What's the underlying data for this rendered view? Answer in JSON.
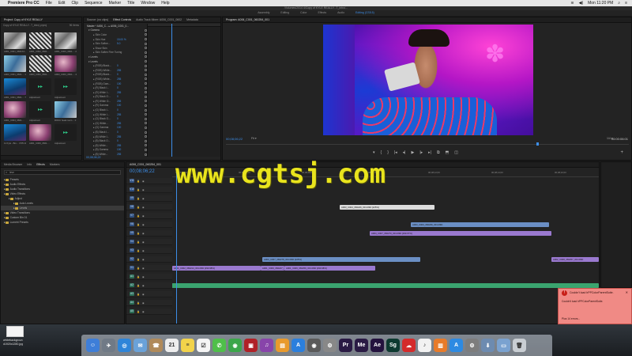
{
  "menubar": {
    "apple": "",
    "app_name": "Premiere Pro CC",
    "items": [
      "File",
      "Edit",
      "Clip",
      "Sequence",
      "Marker",
      "Title",
      "Window",
      "Help"
    ],
    "clock": "Mon 11:20 PM"
  },
  "titlebar": {
    "path": "/Volumes/2014 4/Copy of KYLE REALLY...T_intro/..."
  },
  "workspaces": {
    "tabs": [
      "Assembly",
      "Editing",
      "Color",
      "Effects",
      "Audio",
      "Editing (CS5.5)"
    ],
    "active": "Editing (CS5.5)"
  },
  "project": {
    "tab": "Project: Copy of KYLE REALLY",
    "file": "Copy of KYLE REALLY...T_intro).prproj",
    "items_count": "96 Items",
    "thumbs": [
      {
        "name": "A001_C001_0601X4....",
        "dur": "1:07:04"
      },
      {
        "name": "A001_C002_0601....",
        "dur": ""
      },
      {
        "name": "A001_C003_0601....",
        "dur": "25:00:03"
      },
      {
        "name": "A003_C001_0601....",
        "dur": "1:16:03"
      },
      {
        "name": "A003_C002_0601....",
        "dur": ""
      },
      {
        "name": "A003_C003_0601....",
        "dur": "4:05"
      },
      {
        "name": "A001_C001_0601....",
        "dur": "7:04"
      },
      {
        "name": "Adjustment",
        "dur": ""
      },
      {
        "name": "Adjustment",
        "dur": ""
      },
      {
        "name": "A001_C004_0601....",
        "dur": ""
      },
      {
        "name": "Adjustment",
        "dur": ""
      },
      {
        "name": "ROKU head-room...",
        "dur": "1:16:09"
      },
      {
        "name": "11 Kyle - Bro...",
        "dur": "3:55:14"
      },
      {
        "name": "A001_C006_0601....",
        "dur": ""
      },
      {
        "name": "Adjustment",
        "dur": ""
      }
    ]
  },
  "effect_controls": {
    "tabs": [
      "Source: (no clips)",
      "Effect Controls",
      "Audio Track Mixer: A006_C001_0602",
      "Metadata"
    ],
    "active_tab": "Effect Controls",
    "clip_path": "Master * A006_C... ▸ A006_C001_0...",
    "rows": [
      {
        "label": "Gamma",
        "value": "",
        "section": true
      },
      {
        "label": "Skin Color",
        "value": ""
      },
      {
        "label": "Skin Hue",
        "value": "15.00 %"
      },
      {
        "label": "Skin Softne...",
        "value": "5.0"
      },
      {
        "label": "Show Skin",
        "value": ""
      },
      {
        "label": "Skin Soften Fine Tuning",
        "value": ""
      },
      {
        "label": "Levels",
        "value": "",
        "section": true
      },
      {
        "label": "Levels",
        "value": "",
        "section": true
      },
      {
        "label": "(RGB) Black...",
        "value": "0"
      },
      {
        "label": "(RGB) White...",
        "value": "255"
      },
      {
        "label": "(RGB) Black...",
        "value": "0"
      },
      {
        "label": "(RGB) White...",
        "value": "255"
      },
      {
        "label": "(RGB) Gam...",
        "value": "100"
      },
      {
        "label": "(R) Black I...",
        "value": "0"
      },
      {
        "label": "(R) White I...",
        "value": "255"
      },
      {
        "label": "(R) Black O...",
        "value": "0"
      },
      {
        "label": "(R) White O...",
        "value": "255"
      },
      {
        "label": "(R) Gamma",
        "value": "100"
      },
      {
        "label": "(G) Black I...",
        "value": "0"
      },
      {
        "label": "(G) White I...",
        "value": "255"
      },
      {
        "label": "(G) Black O...",
        "value": "0"
      },
      {
        "label": "(G) White...",
        "value": "255"
      },
      {
        "label": "(G) Gamma",
        "value": "100"
      },
      {
        "label": "(B) Black I...",
        "value": "0"
      },
      {
        "label": "(B) White I...",
        "value": "255"
      },
      {
        "label": "(B) Black O...",
        "value": "0"
      },
      {
        "label": "(B) White...",
        "value": "255"
      },
      {
        "label": "(B) Gamma",
        "value": "100"
      },
      {
        "label": "(B) White...",
        "value": "255"
      }
    ],
    "timecode": "00;08;06;22"
  },
  "program": {
    "tab": "Program: A006_C001_060254_001",
    "timecode": "00;08;06;22",
    "fit": "Fit",
    "scale": "1/4",
    "duration": "00:00:06:01",
    "controls": [
      "▾",
      "{",
      "}",
      "|◂",
      "◂|",
      "▶",
      "|▸",
      "▸|",
      "⧉",
      "⬒",
      "◫"
    ],
    "playhead_fraction": 0.77
  },
  "effects_panel": {
    "tabs": [
      "Media Browser",
      "Info",
      "Effects",
      "Markers"
    ],
    "active_tab": "Effects",
    "search_value": "leve",
    "tree": [
      {
        "label": "Presets",
        "indent": 0
      },
      {
        "label": "Audio Effects",
        "indent": 0
      },
      {
        "label": "Audio Transitions",
        "indent": 0
      },
      {
        "label": "Video Effects",
        "indent": 0
      },
      {
        "label": "Adjust",
        "indent": 1
      },
      {
        "label": "Auto Levels",
        "indent": 2
      },
      {
        "label": "Levels",
        "indent": 2,
        "selected": true
      },
      {
        "label": "Video Transitions",
        "indent": 0
      },
      {
        "label": "Custom Bin 01",
        "indent": 0
      },
      {
        "label": "Lumetri Presets",
        "indent": 0
      }
    ]
  },
  "timeline": {
    "tab": "A006_C001_060254_001",
    "timecode": "00;08;06;22",
    "ticks": [
      "00;08;04;00",
      "00;08;06;00",
      "00;08;08;00",
      "00;08;10;00",
      "00;08;12;00",
      "00;08;14;00",
      "00;08;16;00"
    ],
    "tracks": [
      {
        "name": "V11",
        "kind": "v"
      },
      {
        "name": "V10",
        "kind": "v"
      },
      {
        "name": "V9",
        "kind": "v"
      },
      {
        "name": "V8",
        "kind": "v"
      },
      {
        "name": "V7",
        "kind": "v"
      },
      {
        "name": "V6",
        "kind": "v"
      },
      {
        "name": "V5",
        "kind": "v"
      },
      {
        "name": "V4",
        "kind": "v"
      },
      {
        "name": "V3",
        "kind": "v"
      },
      {
        "name": "V2",
        "kind": "v"
      },
      {
        "name": "V1",
        "kind": "v"
      },
      {
        "name": "A1",
        "kind": "a"
      },
      {
        "name": "A2",
        "kind": "a"
      },
      {
        "name": "A3",
        "kind": "a"
      },
      {
        "name": "A4",
        "kind": "a"
      },
      {
        "name": "A5",
        "kind": "a"
      }
    ],
    "clips": [
      {
        "label": "A003_C004_060246_001.R3D [225%]",
        "color": "white"
      },
      {
        "label": "A003_C003_060236_001.R3D",
        "color": "blue"
      },
      {
        "label": "A004_C007_060270_001.R3D [290.67%]",
        "color": "purple"
      },
      {
        "label": "A003_C007_060278_001.R3D [225%]",
        "color": "blue"
      },
      {
        "label": "A001_C006_060247_001.R3D",
        "color": "purple"
      },
      {
        "label": "A001_C006_060259_001.R3D [290.98%]",
        "color": "purple"
      },
      {
        "label": "A001_C002_060214_001.R3D [290.98%]",
        "color": "purple"
      },
      {
        "label": "A003_C004_060238_001.R3D [500%]",
        "color": "purple"
      },
      {
        "label": "A002_C008_060257_001.R3D",
        "color": "purple"
      }
    ]
  },
  "toast": {
    "title": "Couldn't load hPPColorParentSuite.",
    "body": "Couldn't load hPPColorParentSuite.",
    "more": "Plus 14 errors..."
  },
  "watermark": "www.cgtsj.com",
  "desktop": {
    "file_name": "whitebackgroun d1920x1280.jpg"
  },
  "dock": {
    "apps": [
      {
        "icon": "finder-icon",
        "color": "#3e7ed8",
        "glyph": "☺"
      },
      {
        "icon": "launchpad-icon",
        "color": "#707a86",
        "glyph": "✈"
      },
      {
        "icon": "safari-icon",
        "color": "#2e85d9",
        "glyph": "◎"
      },
      {
        "icon": "mail-icon",
        "color": "#6aa2d9",
        "glyph": "✉"
      },
      {
        "icon": "contacts-icon",
        "color": "#b08a5a",
        "glyph": "☎"
      },
      {
        "icon": "calendar-icon",
        "color": "#eeeeee",
        "glyph": "21"
      },
      {
        "icon": "notes-icon",
        "color": "#f2d34a",
        "glyph": "≡"
      },
      {
        "icon": "reminders-icon",
        "color": "#f5f5f5",
        "glyph": "☑"
      },
      {
        "icon": "messages-icon",
        "color": "#4fbf4a",
        "glyph": "✆"
      },
      {
        "icon": "facetime-icon",
        "color": "#3ba64a",
        "glyph": "◉"
      },
      {
        "icon": "photo-booth-icon",
        "color": "#b02127",
        "glyph": "▣"
      },
      {
        "icon": "itunes-icon",
        "color": "#8844aa",
        "glyph": "♫"
      },
      {
        "icon": "ibooks-icon",
        "color": "#e99a2c",
        "glyph": "▤"
      },
      {
        "icon": "app-store-icon",
        "color": "#2b7fdd",
        "glyph": "A"
      },
      {
        "icon": "dvd-icon",
        "color": "#5a5a5a",
        "glyph": "◉"
      },
      {
        "icon": "system-prefs-icon",
        "color": "#888888",
        "glyph": "⚙"
      },
      {
        "icon": "premiere-icon",
        "color": "#2a1a44",
        "glyph": "Pr"
      },
      {
        "icon": "media-encoder-icon",
        "color": "#2a1a44",
        "glyph": "Me"
      },
      {
        "icon": "after-effects-icon",
        "color": "#24123e",
        "glyph": "Ae"
      },
      {
        "icon": "speedgrade-icon",
        "color": "#0d3a30",
        "glyph": "Sg"
      },
      {
        "icon": "creative-cloud-icon",
        "color": "#d42b2b",
        "glyph": "☁"
      },
      {
        "icon": "music-icon",
        "color": "#f2f2f2",
        "glyph": "♪"
      },
      {
        "icon": "books-icon",
        "color": "#e87b2a",
        "glyph": "▥"
      },
      {
        "icon": "appstore2-icon",
        "color": "#2d8ae2",
        "glyph": "A"
      },
      {
        "icon": "preferences-icon",
        "color": "#7d7d7d",
        "glyph": "⚙"
      },
      {
        "icon": "downloads-icon",
        "color": "#6d8bb0",
        "glyph": "⬇"
      },
      {
        "icon": "folder-icon",
        "color": "#7aa2d0",
        "glyph": "▭"
      },
      {
        "icon": "trash-icon",
        "color": "#c9ced3",
        "glyph": "🗑"
      }
    ]
  }
}
